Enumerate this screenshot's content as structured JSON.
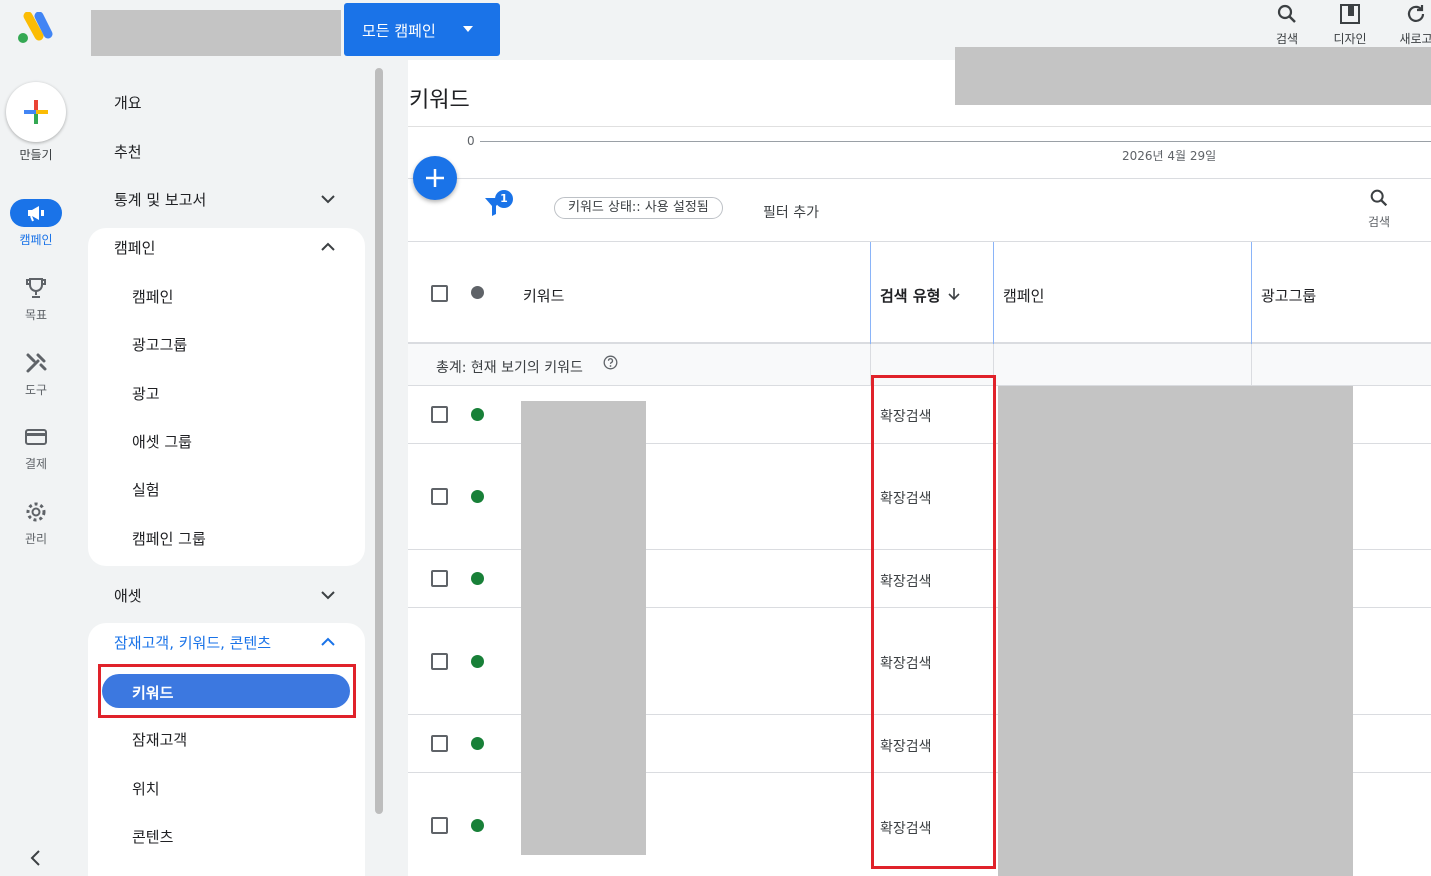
{
  "rail": {
    "create_label": "만들기",
    "items": [
      {
        "label": "캠페인",
        "icon": "megaphone-icon",
        "active": true
      },
      {
        "label": "목표",
        "icon": "trophy-icon"
      },
      {
        "label": "도구",
        "icon": "tools-icon"
      },
      {
        "label": "결제",
        "icon": "credit-card-icon"
      },
      {
        "label": "관리",
        "icon": "gear-icon"
      }
    ]
  },
  "topbar": {
    "campaign_selector": "모든 캠페인",
    "tools": [
      {
        "label": "검색",
        "icon": "search-icon"
      },
      {
        "label": "디자인",
        "icon": "appearance-icon"
      },
      {
        "label": "새로고",
        "icon": "refresh-icon"
      }
    ]
  },
  "nav": {
    "top_items": [
      "개요",
      "추천"
    ],
    "reports": "통계 및 보고서",
    "campaign_group": {
      "title": "캠페인",
      "items": [
        "캠페인",
        "광고그룹",
        "광고",
        "애셋 그룹",
        "실험",
        "캠페인 그룹"
      ]
    },
    "assets": "애셋",
    "audience_group": {
      "title": "잠재고객, 키워드, 콘텐츠",
      "active_item": "키워드",
      "items": [
        "잠재고객",
        "위치",
        "콘텐츠"
      ]
    }
  },
  "page": {
    "title": "키워드",
    "chart": {
      "zero": "0",
      "date": "2026년 4월 29일"
    },
    "filter_count": "1",
    "filter_chip": "키워드 상태:: 사용 설정됨",
    "add_filter": "필터 추가",
    "search_label": "검색"
  },
  "table": {
    "headers": {
      "keyword": "키워드",
      "match_type": "검색 유형",
      "campaign": "캠페인",
      "ad_group": "광고그룹"
    },
    "totals_label": "총계: 현재 보기의 키워드",
    "rows": [
      {
        "match_type": "확장검색"
      },
      {
        "match_type": "확장검색"
      },
      {
        "match_type": "확장검색"
      },
      {
        "match_type": "확장검색"
      },
      {
        "match_type": "확장검색"
      },
      {
        "match_type": "확장검색"
      }
    ]
  },
  "colors": {
    "accent": "#1a73e8",
    "highlight": "#e0222a",
    "status_enabled": "#188038"
  }
}
